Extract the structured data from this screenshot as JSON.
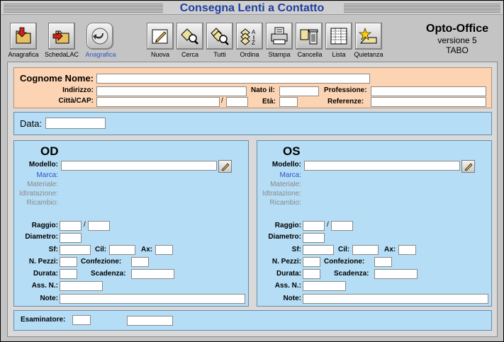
{
  "window": {
    "title": "Consegna Lenti a Contatto"
  },
  "toolbar": {
    "left": [
      {
        "label": "Anagrafica",
        "icon": "folder-arrow-icon"
      },
      {
        "label": "SchedaLAC",
        "icon": "folder-arrow-icon"
      },
      {
        "label": "Anagrafica",
        "icon": "back-arrow-icon",
        "active": true
      }
    ],
    "right": [
      {
        "label": "Nuova",
        "icon": "new-pencil-icon"
      },
      {
        "label": "Cerca",
        "icon": "search-magnifier-icon"
      },
      {
        "label": "Tutti",
        "icon": "show-all-icon"
      },
      {
        "label": "Ordina",
        "icon": "sort-az-icon"
      },
      {
        "label": "Stampa",
        "icon": "printer-icon"
      },
      {
        "label": "Cancella",
        "icon": "trash-icon"
      },
      {
        "label": "Lista",
        "icon": "list-table-icon"
      },
      {
        "label": "Quietanza",
        "icon": "receipt-star-icon"
      }
    ]
  },
  "brand": {
    "name": "Opto-Office",
    "version": "versione 5",
    "user": "TABO"
  },
  "patient": {
    "cognome_label": "Cognome Nome:",
    "indirizzo_label": "Indirizzo:",
    "nato_label": "Nato il:",
    "professione_label": "Professione:",
    "citta_label": "Città/CAP:",
    "slash": "/",
    "eta_label": "Età:",
    "referenze_label": "Referenze:"
  },
  "data_section": {
    "label": "Data:"
  },
  "eyes": {
    "od": {
      "title": "OD"
    },
    "os": {
      "title": "OS"
    },
    "labels": {
      "modello": "Modello:",
      "marca": "Marca:",
      "materiale": "Materiale:",
      "idratazione": "Idtratazione:",
      "ricambio": "Ricambio:",
      "raggio": "Raggio:",
      "slash": "/",
      "diametro": "Diametro:",
      "sf": "Sf:",
      "cil": "Cil:",
      "ax": "Ax:",
      "npezzi": "N. Pezzi:",
      "confezione": "Confezione:",
      "durata": "Durata:",
      "scadenza": "Scadenza:",
      "assn": "Ass. N.:",
      "note": "Note:"
    }
  },
  "footer": {
    "esaminatore_label": "Esaminatore:"
  },
  "colors": {
    "title_blue": "#1f3f9f",
    "panel_blue": "#b5ddf5",
    "panel_peach": "#fcd4b4",
    "link_blue": "#2b56c8"
  }
}
